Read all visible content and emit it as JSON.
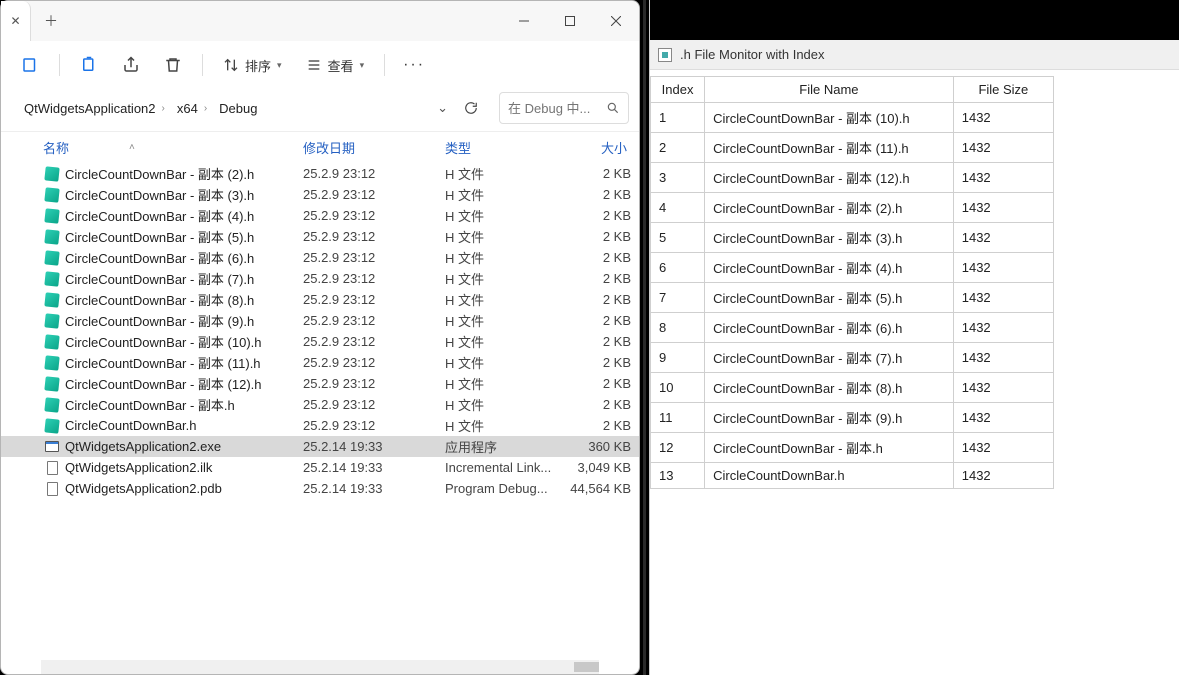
{
  "explorer": {
    "toolbar": {
      "sort_label": "排序",
      "view_label": "查看"
    },
    "breadcrumb": [
      "QtWidgetsApplication2",
      "x64",
      "Debug"
    ],
    "search_placeholder": "在 Debug 中...",
    "columns": {
      "name": "名称",
      "date": "修改日期",
      "type": "类型",
      "size": "大小"
    },
    "rows": [
      {
        "icon": "h",
        "name": "CircleCountDownBar - 副本 (2).h",
        "date": "25.2.9 23:12",
        "type": "H 文件",
        "size": "2 KB",
        "selected": false
      },
      {
        "icon": "h",
        "name": "CircleCountDownBar - 副本 (3).h",
        "date": "25.2.9 23:12",
        "type": "H 文件",
        "size": "2 KB",
        "selected": false
      },
      {
        "icon": "h",
        "name": "CircleCountDownBar - 副本 (4).h",
        "date": "25.2.9 23:12",
        "type": "H 文件",
        "size": "2 KB",
        "selected": false
      },
      {
        "icon": "h",
        "name": "CircleCountDownBar - 副本 (5).h",
        "date": "25.2.9 23:12",
        "type": "H 文件",
        "size": "2 KB",
        "selected": false
      },
      {
        "icon": "h",
        "name": "CircleCountDownBar - 副本 (6).h",
        "date": "25.2.9 23:12",
        "type": "H 文件",
        "size": "2 KB",
        "selected": false
      },
      {
        "icon": "h",
        "name": "CircleCountDownBar - 副本 (7).h",
        "date": "25.2.9 23:12",
        "type": "H 文件",
        "size": "2 KB",
        "selected": false
      },
      {
        "icon": "h",
        "name": "CircleCountDownBar - 副本 (8).h",
        "date": "25.2.9 23:12",
        "type": "H 文件",
        "size": "2 KB",
        "selected": false
      },
      {
        "icon": "h",
        "name": "CircleCountDownBar - 副本 (9).h",
        "date": "25.2.9 23:12",
        "type": "H 文件",
        "size": "2 KB",
        "selected": false
      },
      {
        "icon": "h",
        "name": "CircleCountDownBar - 副本 (10).h",
        "date": "25.2.9 23:12",
        "type": "H 文件",
        "size": "2 KB",
        "selected": false
      },
      {
        "icon": "h",
        "name": "CircleCountDownBar - 副本 (11).h",
        "date": "25.2.9 23:12",
        "type": "H 文件",
        "size": "2 KB",
        "selected": false
      },
      {
        "icon": "h",
        "name": "CircleCountDownBar - 副本 (12).h",
        "date": "25.2.9 23:12",
        "type": "H 文件",
        "size": "2 KB",
        "selected": false
      },
      {
        "icon": "h",
        "name": "CircleCountDownBar - 副本.h",
        "date": "25.2.9 23:12",
        "type": "H 文件",
        "size": "2 KB",
        "selected": false
      },
      {
        "icon": "h",
        "name": "CircleCountDownBar.h",
        "date": "25.2.9 23:12",
        "type": "H 文件",
        "size": "2 KB",
        "selected": false
      },
      {
        "icon": "exe",
        "name": "QtWidgetsApplication2.exe",
        "date": "25.2.14 19:33",
        "type": "应用程序",
        "size": "360 KB",
        "selected": true
      },
      {
        "icon": "doc",
        "name": "QtWidgetsApplication2.ilk",
        "date": "25.2.14 19:33",
        "type": "Incremental Link...",
        "size": "3,049 KB",
        "selected": false
      },
      {
        "icon": "doc",
        "name": "QtWidgetsApplication2.pdb",
        "date": "25.2.14 19:33",
        "type": "Program Debug...",
        "size": "44,564 KB",
        "selected": false
      }
    ]
  },
  "monitor": {
    "title": ".h File Monitor with Index",
    "columns": {
      "index": "Index",
      "name": "File Name",
      "size": "File Size"
    },
    "rows": [
      {
        "index": "1",
        "name": "CircleCountDownBar - 副本 (10).h",
        "size": "1432"
      },
      {
        "index": "2",
        "name": "CircleCountDownBar - 副本 (11).h",
        "size": "1432"
      },
      {
        "index": "3",
        "name": "CircleCountDownBar - 副本 (12).h",
        "size": "1432"
      },
      {
        "index": "4",
        "name": "CircleCountDownBar - 副本 (2).h",
        "size": "1432"
      },
      {
        "index": "5",
        "name": "CircleCountDownBar - 副本 (3).h",
        "size": "1432"
      },
      {
        "index": "6",
        "name": "CircleCountDownBar - 副本 (4).h",
        "size": "1432"
      },
      {
        "index": "7",
        "name": "CircleCountDownBar - 副本 (5).h",
        "size": "1432"
      },
      {
        "index": "8",
        "name": "CircleCountDownBar - 副本 (6).h",
        "size": "1432"
      },
      {
        "index": "9",
        "name": "CircleCountDownBar - 副本 (7).h",
        "size": "1432"
      },
      {
        "index": "10",
        "name": "CircleCountDownBar - 副本 (8).h",
        "size": "1432"
      },
      {
        "index": "11",
        "name": "CircleCountDownBar - 副本 (9).h",
        "size": "1432"
      },
      {
        "index": "12",
        "name": "CircleCountDownBar - 副本.h",
        "size": "1432"
      },
      {
        "index": "13",
        "name": "CircleCountDownBar.h",
        "size": "1432"
      }
    ]
  }
}
